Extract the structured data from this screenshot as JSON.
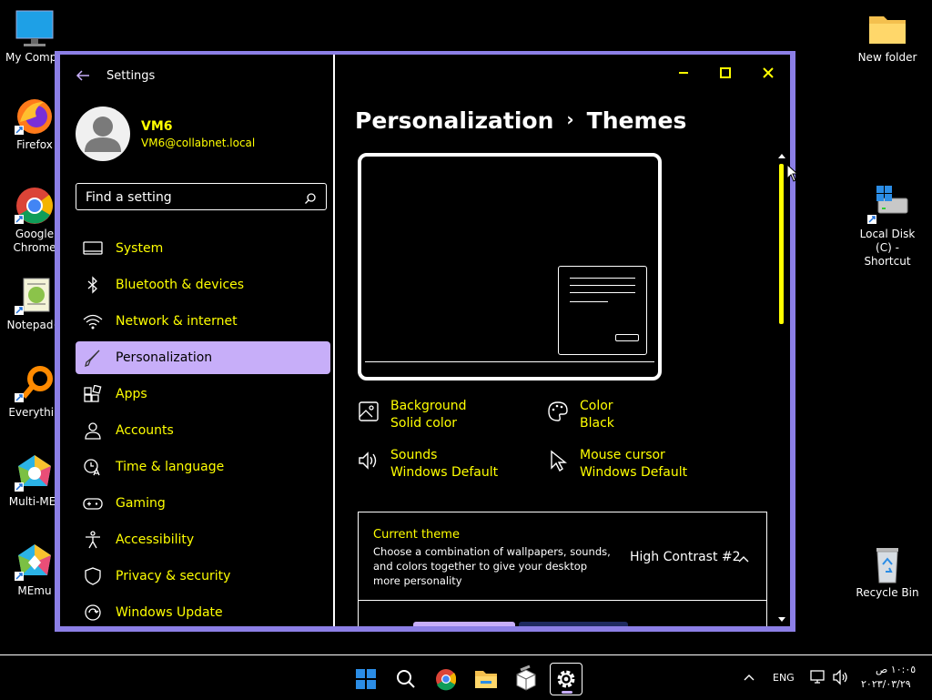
{
  "desktop": {
    "left_icons": [
      {
        "label": "My Compu"
      },
      {
        "label": "Firefox"
      },
      {
        "label": "Google Chrome"
      },
      {
        "label": "Notepad+"
      },
      {
        "label": "Everythin"
      },
      {
        "label": "Multi-MEr"
      },
      {
        "label": "MEmu"
      }
    ],
    "right_icons": [
      {
        "label": "New folder"
      },
      {
        "label": "Local Disk (C) - Shortcut"
      },
      {
        "label": "Recycle Bin"
      }
    ]
  },
  "window": {
    "app_title": "Settings",
    "user": {
      "name": "VM6",
      "email": "VM6@collabnet.local"
    },
    "search": {
      "placeholder": "Find a setting"
    },
    "nav": [
      {
        "label": "System",
        "icon": "monitor-icon"
      },
      {
        "label": "Bluetooth & devices",
        "icon": "bluetooth-icon"
      },
      {
        "label": "Network & internet",
        "icon": "wifi-icon"
      },
      {
        "label": "Personalization",
        "icon": "brush-icon",
        "active": true
      },
      {
        "label": "Apps",
        "icon": "apps-icon"
      },
      {
        "label": "Accounts",
        "icon": "person-icon"
      },
      {
        "label": "Time & language",
        "icon": "globe-clock-icon"
      },
      {
        "label": "Gaming",
        "icon": "gamepad-icon"
      },
      {
        "label": "Accessibility",
        "icon": "accessibility-icon"
      },
      {
        "label": "Privacy & security",
        "icon": "shield-icon"
      },
      {
        "label": "Windows Update",
        "icon": "update-icon"
      }
    ],
    "breadcrumb": {
      "parent": "Personalization",
      "separator": "›",
      "current": "Themes"
    },
    "properties": [
      {
        "name": "Background",
        "value": "Solid color",
        "icon": "image-icon"
      },
      {
        "name": "Color",
        "value": "Black",
        "icon": "palette-icon"
      },
      {
        "name": "Sounds",
        "value": "Windows Default",
        "icon": "speaker-icon"
      },
      {
        "name": "Mouse cursor",
        "value": "Windows Default",
        "icon": "cursor-icon"
      }
    ],
    "current_theme": {
      "title": "Current theme",
      "description": "Choose a combination of wallpapers, sounds, and colors together to give your desktop more personality",
      "value": "High Contrast #2"
    }
  },
  "taskbar": {
    "lang": "ENG",
    "time": "١٠:٠٥ ص",
    "date": "٢٠٢٣/٠٣/٢٩"
  },
  "colors": {
    "accent": "#c7aef9",
    "highlight_text": "#ffff00",
    "window_border": "#8c7fe6"
  }
}
